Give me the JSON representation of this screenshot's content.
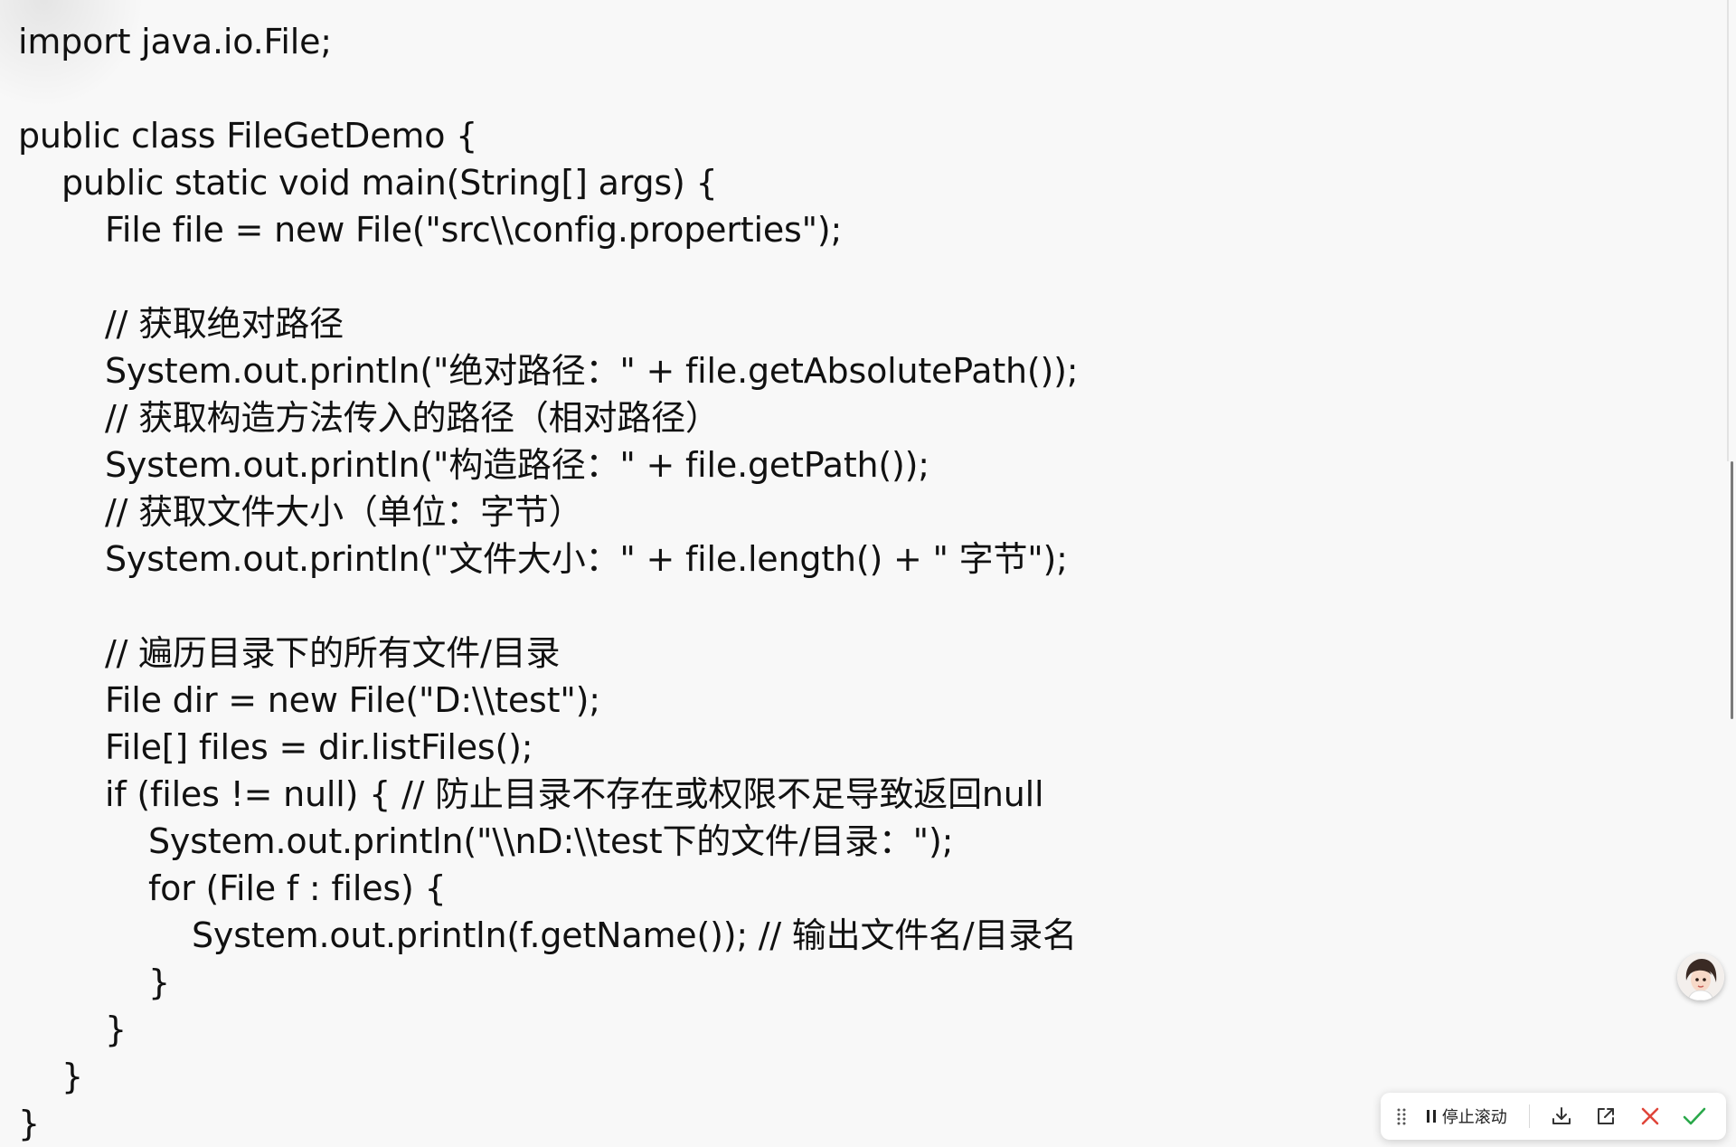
{
  "code_lines": [
    {
      "indent": 0,
      "text": "import java.io.File;"
    },
    {
      "indent": 0,
      "text": ""
    },
    {
      "indent": 0,
      "text": "public class FileGetDemo {"
    },
    {
      "indent": 1,
      "text": "public static void main(String[] args) {"
    },
    {
      "indent": 2,
      "text": "File file = new File(\"src\\\\config.properties\");"
    },
    {
      "indent": 0,
      "text": ""
    },
    {
      "indent": 2,
      "text": "// 获取绝对路径"
    },
    {
      "indent": 2,
      "text": "System.out.println(\"绝对路径：\" + file.getAbsolutePath());"
    },
    {
      "indent": 2,
      "text": "// 获取构造方法传入的路径（相对路径）"
    },
    {
      "indent": 2,
      "text": "System.out.println(\"构造路径：\" + file.getPath());"
    },
    {
      "indent": 2,
      "text": "// 获取文件大小（单位：字节）"
    },
    {
      "indent": 2,
      "text": "System.out.println(\"文件大小：\" + file.length() + \" 字节\");"
    },
    {
      "indent": 0,
      "text": ""
    },
    {
      "indent": 2,
      "text": "// 遍历目录下的所有文件/目录"
    },
    {
      "indent": 2,
      "text": "File dir = new File(\"D:\\\\test\");"
    },
    {
      "indent": 2,
      "text": "File[] files = dir.listFiles();"
    },
    {
      "indent": 2,
      "text": "if (files != null) { // 防止目录不存在或权限不足导致返回null"
    },
    {
      "indent": 3,
      "text": "System.out.println(\"\\\\nD:\\\\test下的文件/目录：\");"
    },
    {
      "indent": 3,
      "text": "for (File f : files) {"
    },
    {
      "indent": 4,
      "text": "System.out.println(f.getName()); // 输出文件名/目录名"
    },
    {
      "indent": 3,
      "text": "}"
    },
    {
      "indent": 2,
      "text": "}"
    },
    {
      "indent": 1,
      "text": "}"
    },
    {
      "indent": 0,
      "text": "}"
    }
  ],
  "toolbar": {
    "stop_scroll_label": "停止滚动",
    "icons": [
      "drag-grip-icon",
      "pause-icon",
      "download-icon",
      "open-external-icon",
      "close-icon",
      "confirm-check-icon"
    ],
    "colors": {
      "close": "#e0453a",
      "confirm": "#2aa84a",
      "icon": "#333333"
    }
  },
  "avatar": {
    "icon": "assistant-avatar-icon"
  }
}
